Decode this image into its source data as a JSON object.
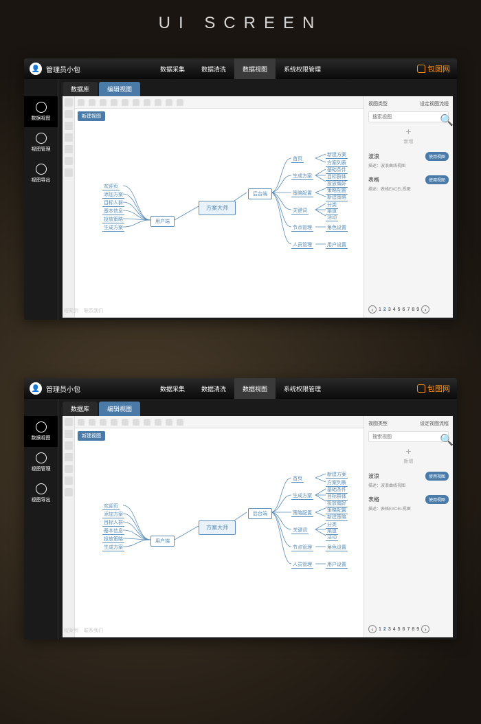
{
  "page_heading": "UI SCREEN",
  "header": {
    "admin_name": "管理员小包",
    "nav": [
      "数据采集",
      "数据清洗",
      "数据视图",
      "系统权限管理"
    ],
    "brand": "包图网"
  },
  "sidebar": {
    "items": [
      {
        "label": "数据视图"
      },
      {
        "label": "视图管理"
      },
      {
        "label": "视图导出"
      }
    ]
  },
  "tabs": [
    "数据库",
    "编辑视图"
  ],
  "new_view_btn": "新建视图",
  "mindmap": {
    "root": "方案大师",
    "client": "用户端",
    "backend": "后台端",
    "client_children": [
      "欢迎页",
      "添加方案",
      "目标人群",
      "基本信息",
      "投放策略",
      "生成方案"
    ],
    "backend_children": [
      "首页",
      "生成方案",
      "策略配置",
      "关键词",
      "节点管理",
      "人员管理"
    ],
    "home_children": [
      "新建方案",
      "方案列表"
    ],
    "gen_children": [
      "基础条件",
      "目标群体",
      "投放偏好"
    ],
    "strategy_children": [
      "策略配置",
      "新建策略"
    ],
    "keyword_children": [
      "分类",
      "渠道",
      "活动"
    ],
    "node_children": [
      "角色设置"
    ],
    "people_children": [
      "用户设置"
    ]
  },
  "panel": {
    "header": [
      "视图类型",
      "设定视图流程"
    ],
    "search_placeholder": "搜索视图",
    "add_label": "新增",
    "items": [
      {
        "name": "波浪",
        "desc": "描述：波浪曲线视图",
        "btn": "使用视图"
      },
      {
        "name": "表格",
        "desc": "描述：表格EXCEL视图",
        "btn": "使用视图"
      }
    ],
    "pages": [
      "1",
      "2",
      "3",
      "4",
      "5",
      "6",
      "7",
      "8",
      "9"
    ]
  },
  "footer": [
    "程案例",
    "联系我们"
  ]
}
